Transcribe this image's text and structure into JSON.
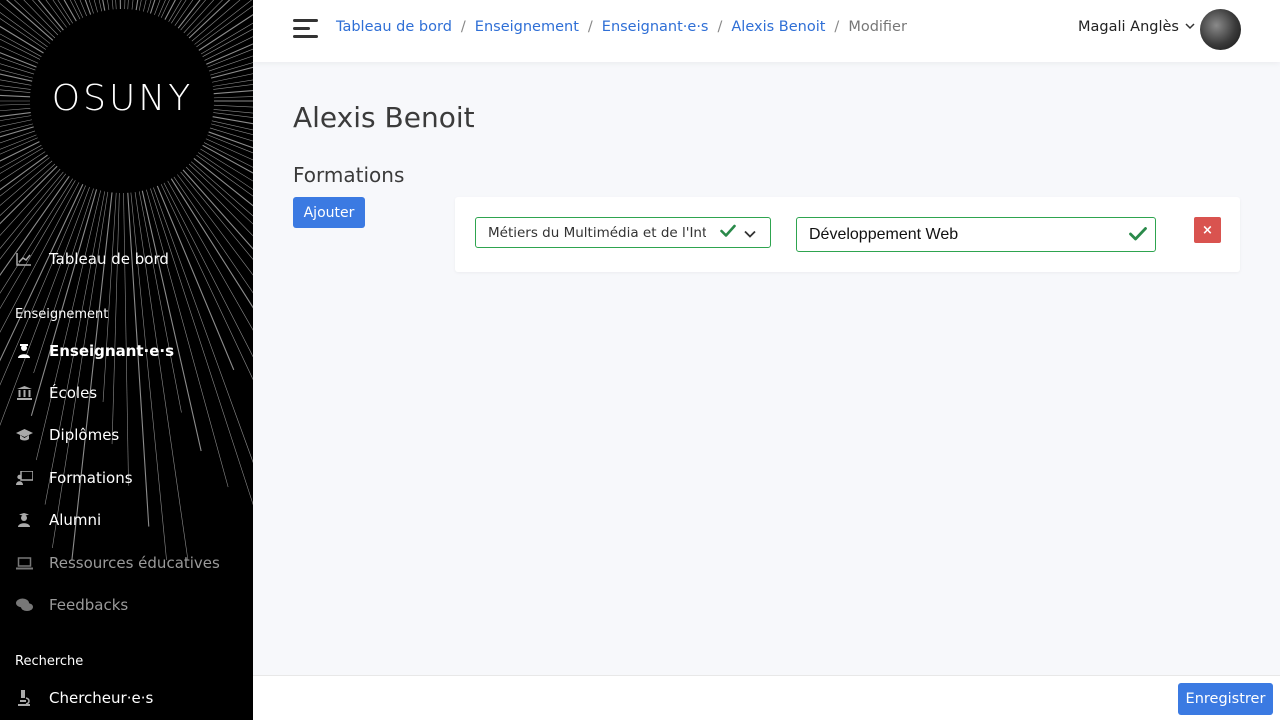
{
  "brand": {
    "logo": "OSUNY"
  },
  "sidebar": {
    "items": [
      {
        "label": "Tableau de bord",
        "icon": "chart-line-icon"
      },
      {
        "label": "Enseignant·e·s",
        "icon": "teacher-icon"
      },
      {
        "label": "Écoles",
        "icon": "institution-icon"
      },
      {
        "label": "Diplômes",
        "icon": "graduation-cap-icon"
      },
      {
        "label": "Formations",
        "icon": "chalkboard-teacher-icon"
      },
      {
        "label": "Alumni",
        "icon": "user-graduate-icon"
      },
      {
        "label": "Ressources éducatives",
        "icon": "laptop-icon"
      },
      {
        "label": "Feedbacks",
        "icon": "comments-icon"
      },
      {
        "label": "Chercheur·e·s",
        "icon": "microscope-icon"
      }
    ],
    "sections": [
      "Enseignement",
      "Recherche"
    ]
  },
  "header": {
    "breadcrumb": [
      "Tableau de bord",
      "Enseignement",
      "Enseignant·e·s",
      "Alexis Benoit",
      "Modifier"
    ],
    "user_name": "Magali Anglès"
  },
  "main": {
    "title": "Alexis Benoit",
    "section_title": "Formations",
    "add_label": "Ajouter",
    "program_select_value": "Métiers du Multimédia et de l'Internet",
    "role_input_value": "Développement Web",
    "delete_label": "×"
  },
  "footer": {
    "save_label": "Enregistrer"
  },
  "colors": {
    "primary": "#3b7ae2",
    "valid": "#2ea44f",
    "danger": "#d9534f",
    "link": "#2f6fd6"
  }
}
